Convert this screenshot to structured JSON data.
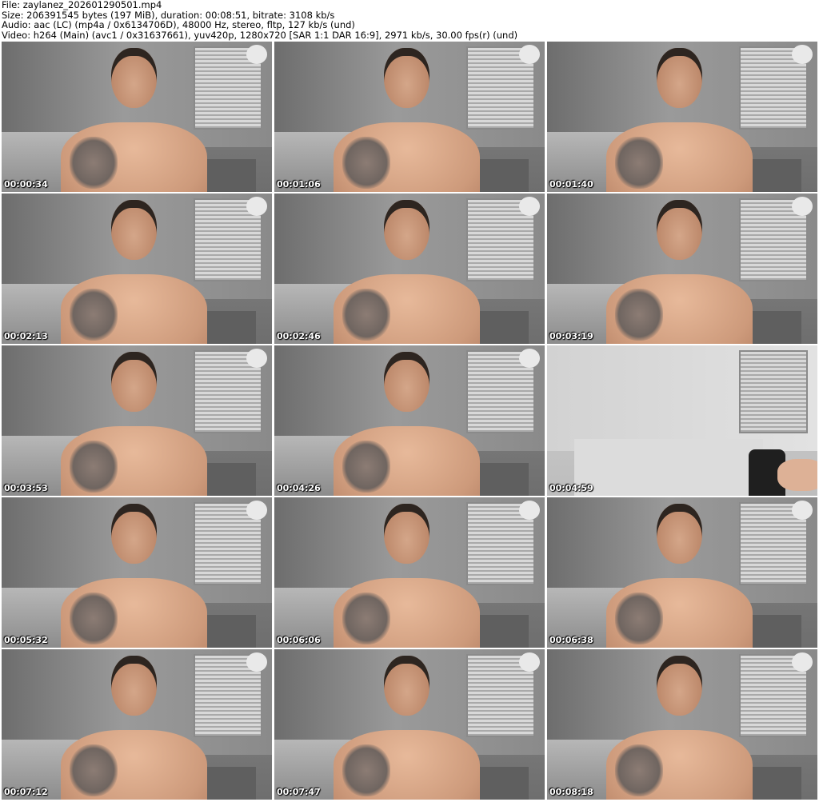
{
  "header": {
    "file": "File: zaylanez_202601290501.mp4",
    "size": "Size: 206391545 bytes (197 MiB), duration: 00:08:51, bitrate: 3108 kb/s",
    "audio": "Audio: aac (LC) (mp4a / 0x6134706D), 48000 Hz, stereo, fltp, 127 kb/s (und)",
    "video": "Video: h264 (Main) (avc1 / 0x31637661), yuv420p, 1280x720 [SAR 1:1 DAR 16:9], 2971 kb/s, 30.00 fps(r) (und)"
  },
  "thumbnails": [
    "00:00:34",
    "00:01:06",
    "00:01:40",
    "00:02:13",
    "00:02:46",
    "00:03:19",
    "00:03:53",
    "00:04:26",
    "00:04:59",
    "00:05:32",
    "00:06:06",
    "00:06:38",
    "00:07:12",
    "00:07:47",
    "00:08:18"
  ]
}
